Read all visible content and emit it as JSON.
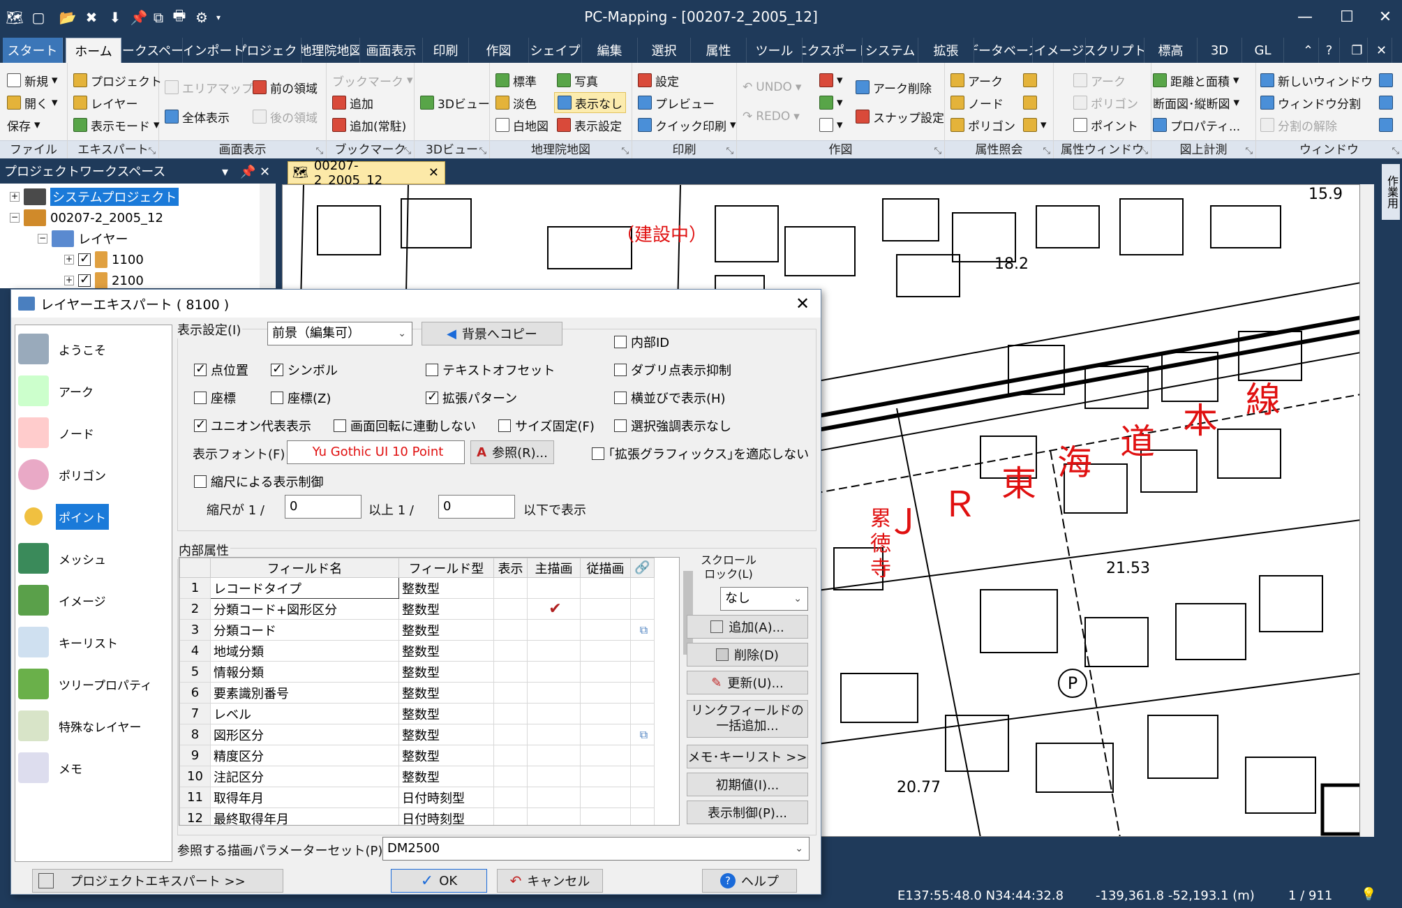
{
  "app": {
    "title": "PC-Mapping - [00207-2_2005_12]"
  },
  "ribbon_tabs": [
    "スタート",
    "ホーム",
    "ワークスペース",
    "インポート",
    "プロジェクト",
    "地理院地図",
    "画面表示",
    "印刷",
    "作図",
    "シェイプ",
    "編集",
    "選択",
    "属性",
    "ツール",
    "エクスポート",
    "システム",
    "拡張",
    "データベース",
    "イメージ",
    "スクリプト",
    "標高",
    "3D",
    "GL"
  ],
  "ribbon": {
    "file": {
      "label": "ファイル",
      "new": "新規",
      "open": "開く",
      "save": "保存"
    },
    "expert": {
      "label": "エキスパート",
      "project": "プロジェクト",
      "layer": "レイヤー",
      "display_mode": "表示モード"
    },
    "display": {
      "label": "画面表示",
      "area_map": "エリアマップ",
      "full_view": "全体表示",
      "prev_area": "前の領域",
      "next_area": "後の領域"
    },
    "bookmark": {
      "label": "ブックマーク",
      "bookmark": "ブックマーク",
      "add": "追加",
      "add_resident": "追加(常駐)"
    },
    "view3d": {
      "label": "3Dビュー",
      "btn": "3Dビュー"
    },
    "gsi": {
      "label": "地理院地図",
      "standard": "標準",
      "pale": "淡色",
      "blank": "白地図",
      "photo": "写真",
      "hidden": "表示なし",
      "settings": "表示設定"
    },
    "print": {
      "label": "印刷",
      "settings": "設定",
      "preview": "プレビュー",
      "quick": "クイック印刷"
    },
    "draw": {
      "label": "作図",
      "undo": "UNDO",
      "redo": "REDO",
      "arc_delete": "アーク削除",
      "snap": "スナップ設定"
    },
    "attr_query": {
      "label": "属性照会",
      "arc": "アーク",
      "node": "ノード",
      "polygon": "ポリゴン"
    },
    "attr_window": {
      "label": "属性ウィンドウ",
      "arc": "アーク",
      "polygon": "ポリゴン",
      "point": "ポイント"
    },
    "measure": {
      "label": "図上計測",
      "distance": "距離と面積",
      "section": "断面図･縦断図",
      "property": "プロパティ..."
    },
    "window": {
      "label": "ウィンドウ",
      "new": "新しいウィンドウ",
      "split": "ウィンドウ分割",
      "unsplit": "分割の解除"
    }
  },
  "workspace": {
    "title": "プロジェクトワークスペース",
    "items": [
      {
        "label": "システムプロジェクト",
        "level": 0
      },
      {
        "label": "00207-2_2005_12",
        "level": 0
      },
      {
        "label": "レイヤー",
        "level": 1
      },
      {
        "label": "1100",
        "level": 2
      },
      {
        "label": "2100",
        "level": 2
      }
    ]
  },
  "document_tab": "00207-2_2005_12",
  "side_strip": "作業用",
  "map_labels": {
    "under_construction": "（建設中）",
    "jr_line": [
      "Ｊ",
      "Ｒ",
      "東",
      "海",
      "道",
      "本",
      "線"
    ],
    "temple": [
      "累",
      "徳",
      "寺"
    ],
    "elevations": [
      "15.9",
      "18.2",
      "21.53",
      "20.77"
    ],
    "parking": "P"
  },
  "status": {
    "coords": "E137:55:48.0 N34:44:32.8",
    "xy": "-139,361.8 -52,193.1 (m)",
    "page": "1 / 911"
  },
  "dialog": {
    "title": "レイヤーエキスパート ( 8100 )",
    "nav": [
      "ようこそ",
      "アーク",
      "ノード",
      "ポリゴン",
      "ポイント",
      "メッシュ",
      "イメージ",
      "キーリスト",
      "ツリープロパティ",
      "特殊なレイヤー",
      "メモ"
    ],
    "selected_nav": "ポイント",
    "display_settings": "表示設定(I)",
    "foreground": "前景（編集可）",
    "copy_to_bg": "背景へコピー",
    "checks": {
      "point_pos": "点位置",
      "symbol": "シンボル",
      "text_offset": "テキストオフセット",
      "internal_id": "内部ID",
      "dup_suppress": "ダブリ点表示抑制",
      "coord": "座標",
      "coord_z": "座標(Z)",
      "ext_pattern": "拡張パターン",
      "side_by_side": "横並びで表示(H)",
      "union_rep": "ユニオン代表表示",
      "no_rotate": "画面回転に連動しない",
      "fixed_size": "サイズ固定(F)",
      "no_highlight": "選択強調表示なし",
      "no_ext_graphics": "｢拡張グラフィックス｣を適応しない",
      "scale_control": "縮尺による表示制御"
    },
    "font_label": "表示フォント(F)",
    "font_value": "Yu Gothic UI 10 Point",
    "browse": "参照(R)...",
    "scale": {
      "prefix": "縮尺が 1 /",
      "min": "0",
      "mid": "以上  1 /",
      "max": "0",
      "suffix": "以下で表示"
    },
    "internal_attrs": "内部属性",
    "columns": [
      "フィールド名",
      "フィールド型",
      "表示",
      "主描画",
      "従描画"
    ],
    "rows": [
      {
        "no": "1",
        "name": "レコードタイプ",
        "type": "整数型",
        "main": "",
        "link": ""
      },
      {
        "no": "2",
        "name": "分類コード+図形区分",
        "type": "整数型",
        "main": "✔",
        "link": ""
      },
      {
        "no": "3",
        "name": "分類コード",
        "type": "整数型",
        "main": "",
        "link": "⧉"
      },
      {
        "no": "4",
        "name": "地域分類",
        "type": "整数型",
        "main": "",
        "link": ""
      },
      {
        "no": "5",
        "name": "情報分類",
        "type": "整数型",
        "main": "",
        "link": ""
      },
      {
        "no": "6",
        "name": "要素識別番号",
        "type": "整数型",
        "main": "",
        "link": ""
      },
      {
        "no": "7",
        "name": "レベル",
        "type": "整数型",
        "main": "",
        "link": ""
      },
      {
        "no": "8",
        "name": "図形区分",
        "type": "整数型",
        "main": "",
        "link": "⧉"
      },
      {
        "no": "9",
        "name": "精度区分",
        "type": "整数型",
        "main": "",
        "link": ""
      },
      {
        "no": "10",
        "name": "注記区分",
        "type": "整数型",
        "main": "",
        "link": ""
      },
      {
        "no": "11",
        "name": "取得年月",
        "type": "日付時刻型",
        "main": "",
        "link": ""
      },
      {
        "no": "12",
        "name": "最終取得年月",
        "type": "日付時刻型",
        "main": "",
        "link": ""
      }
    ],
    "scroll_lock": "スクロール\nロック(L)",
    "scroll_lock_value": "なし",
    "buttons": {
      "add": "追加(A)...",
      "delete": "削除(D)",
      "update": "更新(U)...",
      "link_bulk": "リンクフィールドの\n一括追加...",
      "memo_keylist": "メモ･キーリスト >>",
      "initial": "初期値(I)...",
      "display_ctrl": "表示制御(P)..."
    },
    "param_set_label": "参照する描画パラメーターセット(P)",
    "param_set_value": "DM2500",
    "project_expert": "プロジェクトエキスパート >>",
    "ok": "OK",
    "cancel": "キャンセル",
    "help": "ヘルプ"
  }
}
